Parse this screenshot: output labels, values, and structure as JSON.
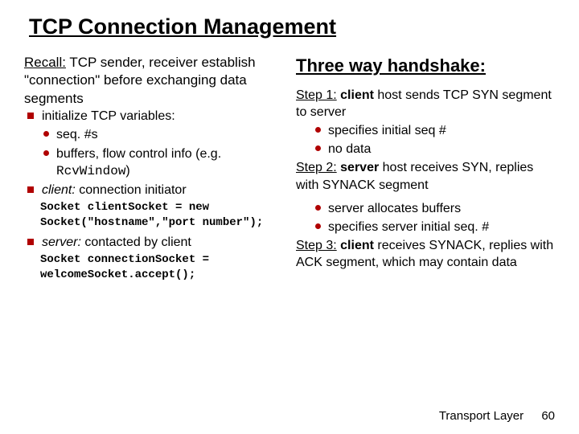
{
  "title": "TCP Connection Management",
  "left": {
    "recall_label": "Recall:",
    "recall_text": " TCP sender, receiver establish \"connection\" before exchanging data segments",
    "b1": "initialize TCP variables:",
    "b1s1": "seq. #s",
    "b1s2_a": "buffers, flow control info (e.g. ",
    "b1s2_code": "RcvWindow",
    "b1s2_b": ")",
    "b2_a": "client:",
    "b2_b": " connection initiator",
    "code1": "Socket clientSocket = new Socket(\"hostname\",\"port number\");",
    "b3_a": "server:",
    "b3_b": " contacted by client",
    "code2": "Socket connectionSocket = welcomeSocket.accept();"
  },
  "right": {
    "heading": "Three way handshake:",
    "s1_label": "Step 1:",
    "s1_a": " client",
    "s1_b": " host sends TCP SYN segment to server",
    "s1_m1": "specifies initial seq #",
    "s1_m2": "no data",
    "s2_label": "Step 2:",
    "s2_a": " server",
    "s2_b": " host receives SYN, replies with SYNACK segment",
    "s2_m1": "server allocates buffers",
    "s2_m2": "specifies server initial seq. #",
    "s3_label": "Step 3:",
    "s3_a": " client",
    "s3_b": " receives SYNACK, replies with ACK segment, which may contain data"
  },
  "footer": {
    "label": "Transport Layer",
    "page": "60"
  }
}
